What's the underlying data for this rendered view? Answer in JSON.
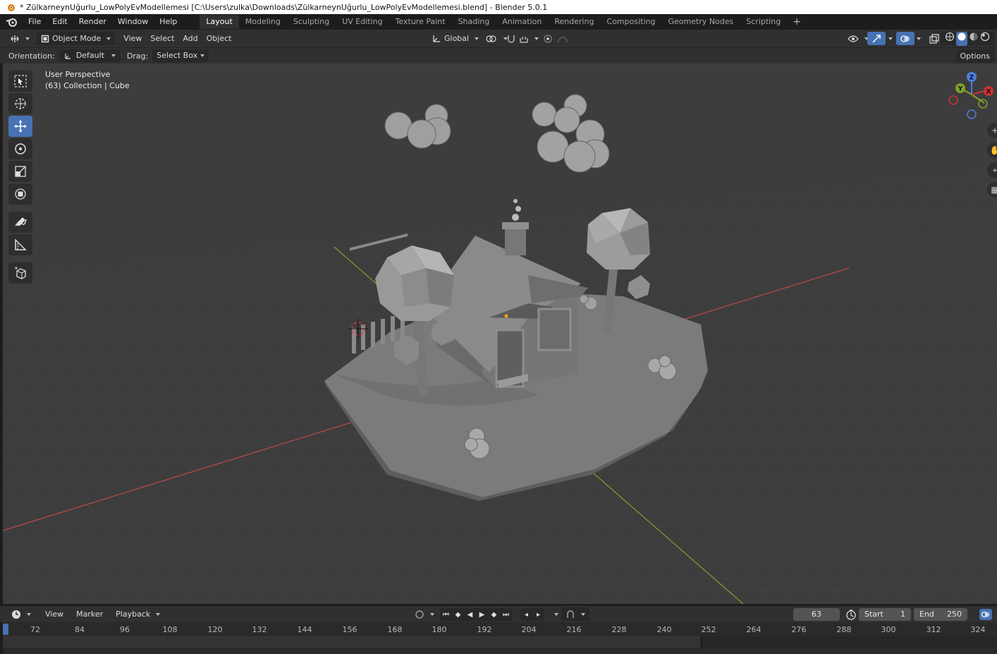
{
  "window": {
    "title": "* ZülkarneynUğurlu_LowPolyEvModellemesi [C:\\Users\\zulka\\Downloads\\ZülkarneynUğurlu_LowPolyEvModellemesi.blend] - Blender 5.0.1"
  },
  "menu": [
    "File",
    "Edit",
    "Render",
    "Window",
    "Help"
  ],
  "workspaces": [
    "Layout",
    "Modeling",
    "Sculpting",
    "UV Editing",
    "Texture Paint",
    "Shading",
    "Animation",
    "Rendering",
    "Compositing",
    "Geometry Nodes",
    "Scripting"
  ],
  "active_workspace": "Layout",
  "viewport_header": {
    "mode": "Object Mode",
    "menus": [
      "View",
      "Select",
      "Add",
      "Object"
    ],
    "transform_orientation": "Global"
  },
  "tool_settings": {
    "orientation_label": "Orientation:",
    "orientation_value": "Default",
    "drag_label": "Drag:",
    "drag_value": "Select Box",
    "options_label": "Options"
  },
  "viewport": {
    "perspective": "User Perspective",
    "collection_info": "(63) Collection | Cube",
    "gizmo_axes": [
      "X",
      "Y",
      "Z"
    ]
  },
  "tools": [
    "select-box",
    "cursor",
    "move",
    "rotate",
    "scale",
    "transform",
    "annotate",
    "measure",
    "add-cube"
  ],
  "timeline": {
    "menus": [
      "View",
      "Marker",
      "Playback"
    ],
    "current_frame": "63",
    "start_label": "Start",
    "start_value": "1",
    "end_label": "End",
    "end_value": "250",
    "ruler": [
      "72",
      "84",
      "96",
      "108",
      "120",
      "132",
      "144",
      "156",
      "168",
      "180",
      "192",
      "204",
      "216",
      "228",
      "240",
      "252",
      "264",
      "276",
      "288",
      "300",
      "312",
      "324"
    ]
  },
  "colors": {
    "accent": "#4772b3",
    "viewport_bg": "#3d3d3d",
    "axis_x": "#b94a4a",
    "axis_y": "#7fa02c"
  }
}
